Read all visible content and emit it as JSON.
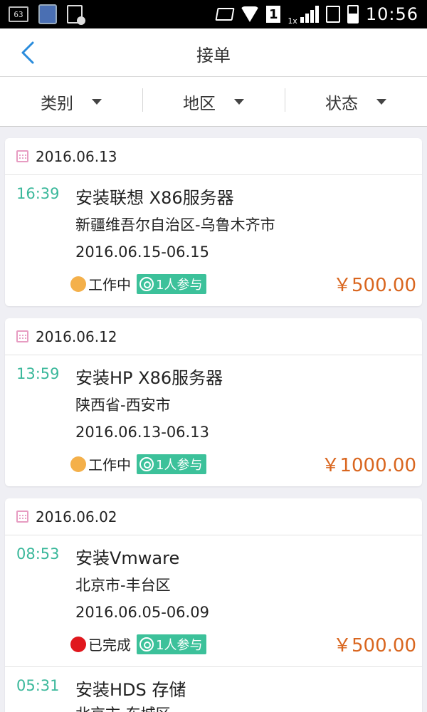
{
  "statusbar": {
    "notification_count": "63",
    "sim_label": "1",
    "network_type": "1x",
    "time": "10:56"
  },
  "header": {
    "title": "接单"
  },
  "filters": [
    {
      "label": "类别"
    },
    {
      "label": "地区"
    },
    {
      "label": "状态"
    }
  ],
  "orders": [
    {
      "date": "2016.06.13",
      "time": "16:39",
      "name": "安装联想 X86服务器",
      "region": "新疆维吾尔自治区-乌鲁木齐市",
      "range": "2016.06.15-06.15",
      "status": "工作中",
      "status_color": "#f4b04a",
      "participants": "1人参与",
      "price": "￥500.00"
    },
    {
      "date": "2016.06.12",
      "time": "13:59",
      "name": "安装HP X86服务器",
      "region": "陕西省-西安市",
      "range": "2016.06.13-06.13",
      "status": "工作中",
      "status_color": "#f4b04a",
      "participants": "1人参与",
      "price": "￥1000.00"
    },
    {
      "date": "2016.06.02",
      "time": "08:53",
      "name": "安装Vmware",
      "region": "北京市-丰台区",
      "range": "2016.06.05-06.09",
      "status": "已完成",
      "status_color": "#e0171d",
      "participants": "1人参与",
      "price": "￥500.00"
    },
    {
      "time": "05:31",
      "name": "安装HDS 存储",
      "region": "北京市-东城区"
    }
  ],
  "colors": {
    "accent": "#2a8cdc",
    "time_green": "#3bb89b",
    "badge_green": "#3cc19a",
    "price_orange": "#d9661f"
  }
}
